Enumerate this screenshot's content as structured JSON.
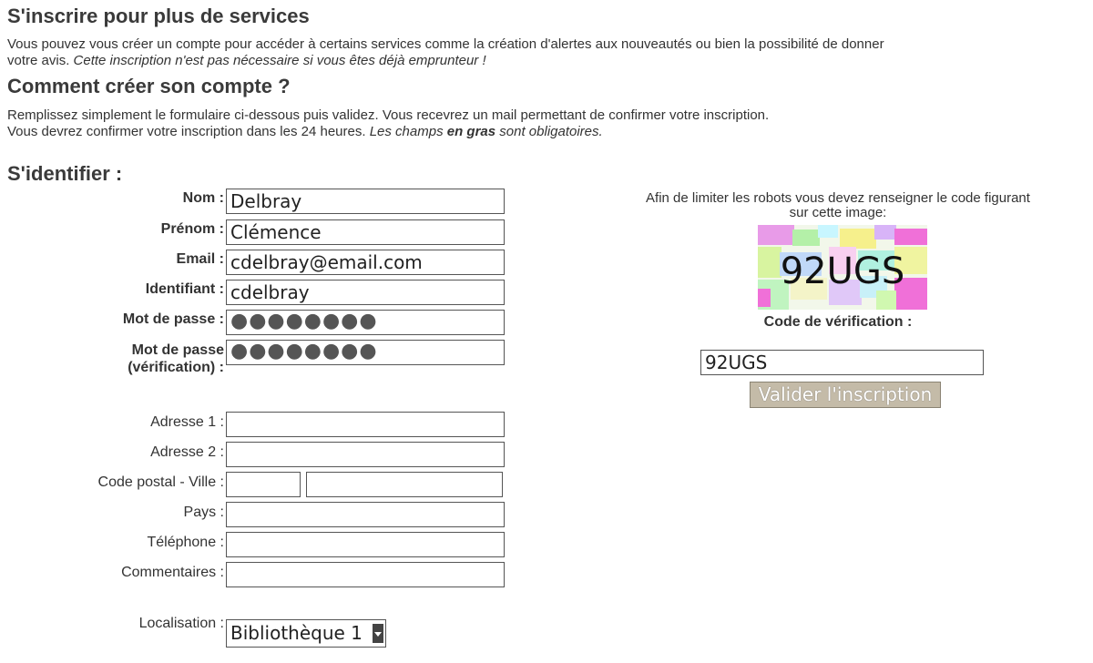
{
  "section1": {
    "title": "S'inscrire pour plus de services",
    "text_line1": "Vous pouvez vous créer un compte pour accéder à certains services comme la création d'alertes aux nouveautés ou bien la possibilité de donner",
    "text_line2_normal": "votre avis. ",
    "text_line2_italic": "Cette inscription n'est pas nécessaire si vous êtes déjà emprunteur !"
  },
  "section2": {
    "title": "Comment créer son compte ?",
    "text_line1": "Remplissez simplement le formulaire ci-dessous puis validez. Vous recevrez un mail permettant de confirmer votre inscription.",
    "text_line2_normal": "Vous devrez confirmer votre inscription dans les 24 heures. ",
    "text_line2_italic_a": "Les champs ",
    "text_line2_bold": "en gras",
    "text_line2_italic_b": " sont obligatoires."
  },
  "form": {
    "title": "S'identifier :",
    "fields": {
      "nom": {
        "label": "Nom :",
        "value": "Delbray"
      },
      "prenom": {
        "label": "Prénom :",
        "value": "Clémence"
      },
      "email": {
        "label": "Email :",
        "value": "cdelbray@email.com"
      },
      "identifiant": {
        "label": "Identifiant :",
        "value": "cdelbray"
      },
      "password": {
        "label": "Mot de passe :",
        "value": "●●●●●●●●"
      },
      "password_confirm": {
        "label_line1": "Mot de passe",
        "label_line2": "(vérification) :",
        "value": "●●●●●●●●"
      },
      "adresse1": {
        "label": "Adresse 1 :",
        "value": ""
      },
      "adresse2": {
        "label": "Adresse 2 :",
        "value": ""
      },
      "code_postal_ville": {
        "label": "Code postal - Ville :",
        "postal_value": "",
        "city_value": ""
      },
      "pays": {
        "label": "Pays :",
        "value": ""
      },
      "telephone": {
        "label": "Téléphone :",
        "value": ""
      },
      "commentaires": {
        "label": "Commentaires :",
        "value": ""
      },
      "localisation": {
        "label": "Localisation :",
        "selected": "Bibliothèque 1"
      }
    }
  },
  "captcha": {
    "instruction": "Afin de limiter les robots vous devez renseigner le code figurant",
    "instruction_line2": "sur cette image:",
    "image_text": "92UGS",
    "code_label": "Code de vérification :",
    "code_value": "92UGS",
    "submit_label": "Valider l'inscription"
  },
  "colors": {
    "button_bg": "#c4bba8",
    "heading": "#3a3a3a"
  }
}
